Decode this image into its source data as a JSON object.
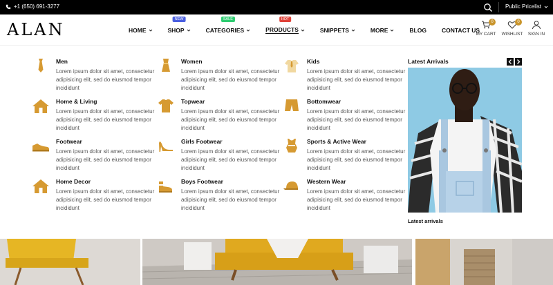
{
  "topbar": {
    "phone": "+1 (650) 691-3277",
    "pricelist": "Public Pricelist"
  },
  "brand": {
    "logo": "ALAN"
  },
  "nav": {
    "items": [
      {
        "label": "HOME",
        "badge": ""
      },
      {
        "label": "SHOP",
        "badge": "NEW"
      },
      {
        "label": "CATEGORIES",
        "badge": "SALE"
      },
      {
        "label": "PRODUCTS",
        "badge": "HOT"
      },
      {
        "label": "SNIPPETS",
        "badge": ""
      },
      {
        "label": "MORE",
        "badge": ""
      },
      {
        "label": "BLOG",
        "badge": ""
      },
      {
        "label": "CONTACT US",
        "badge": ""
      }
    ],
    "badge_colors": {
      "NEW": "#4a5fe0",
      "SALE": "#2ecc71",
      "HOT": "#e0433a"
    }
  },
  "header_icons": {
    "cart": {
      "label": "MY CART",
      "count": "0"
    },
    "wishlist": {
      "label": "WISHLIST",
      "count": "0"
    },
    "signin": {
      "label": "SIGN IN"
    }
  },
  "mega_menu": {
    "description": "Lorem ipsum dolor sit amet, consectetur adipisicing elit, sed do eiusmod tempor incididunt",
    "categories": [
      {
        "title": "Men",
        "icon": "tie-icon"
      },
      {
        "title": "Women",
        "icon": "dress-icon"
      },
      {
        "title": "Kids",
        "icon": "kids-shirt-icon"
      },
      {
        "title": "Home & Living",
        "icon": "house-icon"
      },
      {
        "title": "Topwear",
        "icon": "tshirt-icon"
      },
      {
        "title": "Bottomwear",
        "icon": "shorts-icon"
      },
      {
        "title": "Footwear",
        "icon": "sneaker-icon"
      },
      {
        "title": "Girls Footwear",
        "icon": "heel-icon"
      },
      {
        "title": "Sports & Active Wear",
        "icon": "sports-top-icon"
      },
      {
        "title": "Home Decor",
        "icon": "home-decor-icon"
      },
      {
        "title": "Boys Footwear",
        "icon": "sandal-icon"
      },
      {
        "title": "Western Wear",
        "icon": "cap-icon"
      }
    ],
    "latest_arrivals": {
      "heading": "Latest Arrivals",
      "caption": "Latest arrivals"
    }
  },
  "colors": {
    "accent": "#c9952c",
    "topbar": "#000000"
  }
}
